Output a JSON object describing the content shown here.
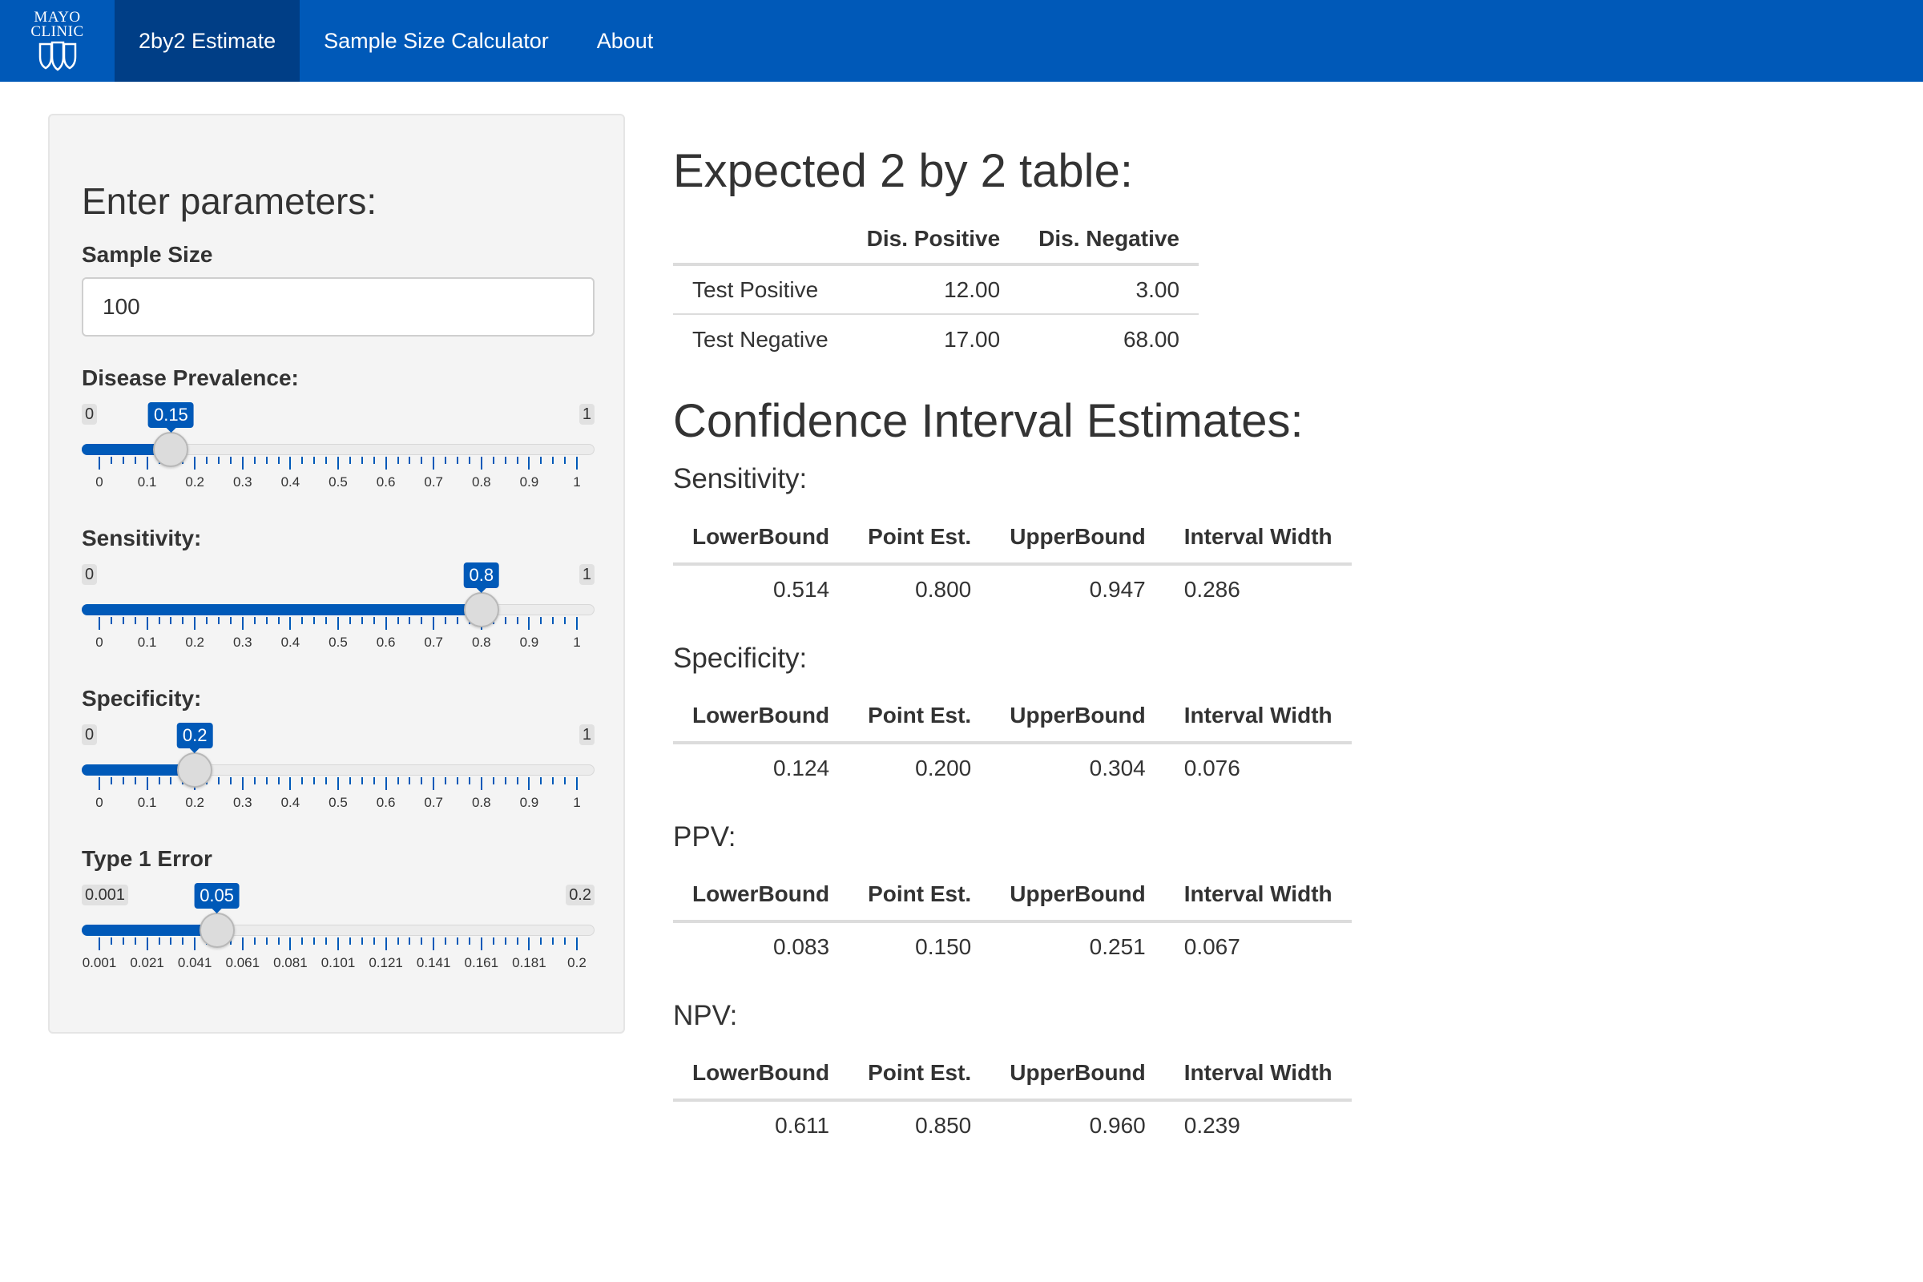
{
  "nav": {
    "logo_line1": "MAYO",
    "logo_line2": "CLINIC",
    "tabs": [
      {
        "label": "2by2 Estimate",
        "active": true
      },
      {
        "label": "Sample Size Calculator",
        "active": false
      },
      {
        "label": "About",
        "active": false
      }
    ]
  },
  "sidebar": {
    "title": "Enter parameters:",
    "sample_size_label": "Sample Size",
    "sample_size_value": "100",
    "sliders": [
      {
        "label": "Disease Prevalence:",
        "min": "0",
        "max": "1",
        "value": "0.15",
        "fraction": 0.15,
        "tick_labels": [
          "0",
          "0.1",
          "0.2",
          "0.3",
          "0.4",
          "0.5",
          "0.6",
          "0.7",
          "0.8",
          "0.9",
          "1"
        ]
      },
      {
        "label": "Sensitivity:",
        "min": "0",
        "max": "1",
        "value": "0.8",
        "fraction": 0.8,
        "tick_labels": [
          "0",
          "0.1",
          "0.2",
          "0.3",
          "0.4",
          "0.5",
          "0.6",
          "0.7",
          "0.8",
          "0.9",
          "1"
        ]
      },
      {
        "label": "Specificity:",
        "min": "0",
        "max": "1",
        "value": "0.2",
        "fraction": 0.2,
        "tick_labels": [
          "0",
          "0.1",
          "0.2",
          "0.3",
          "0.4",
          "0.5",
          "0.6",
          "0.7",
          "0.8",
          "0.9",
          "1"
        ]
      },
      {
        "label": "Type 1 Error",
        "min": "0.001",
        "max": "0.2",
        "value": "0.05",
        "fraction": 0.246,
        "tick_labels": [
          "0.001",
          "0.021",
          "0.041",
          "0.061",
          "0.081",
          "0.101",
          "0.121",
          "0.141",
          "0.161",
          "0.181",
          "0.2"
        ]
      }
    ]
  },
  "main": {
    "table_title": "Expected 2 by 2 table:",
    "table2x2": {
      "headers": [
        "",
        "Dis. Positive",
        "Dis. Negative"
      ],
      "rows": [
        [
          "Test Positive",
          "12.00",
          "3.00"
        ],
        [
          "Test Negative",
          "17.00",
          "68.00"
        ]
      ]
    },
    "ci_title": "Confidence Interval Estimates:",
    "ci_headers": [
      "LowerBound",
      "Point Est.",
      "UpperBound",
      "Interval Width"
    ],
    "ci_sections": [
      {
        "label": "Sensitivity:",
        "values": [
          "0.514",
          "0.800",
          "0.947",
          "0.286"
        ]
      },
      {
        "label": "Specificity:",
        "values": [
          "0.124",
          "0.200",
          "0.304",
          "0.076"
        ]
      },
      {
        "label": "PPV:",
        "values": [
          "0.083",
          "0.150",
          "0.251",
          "0.067"
        ]
      },
      {
        "label": "NPV:",
        "values": [
          "0.611",
          "0.850",
          "0.960",
          "0.239"
        ]
      }
    ]
  }
}
